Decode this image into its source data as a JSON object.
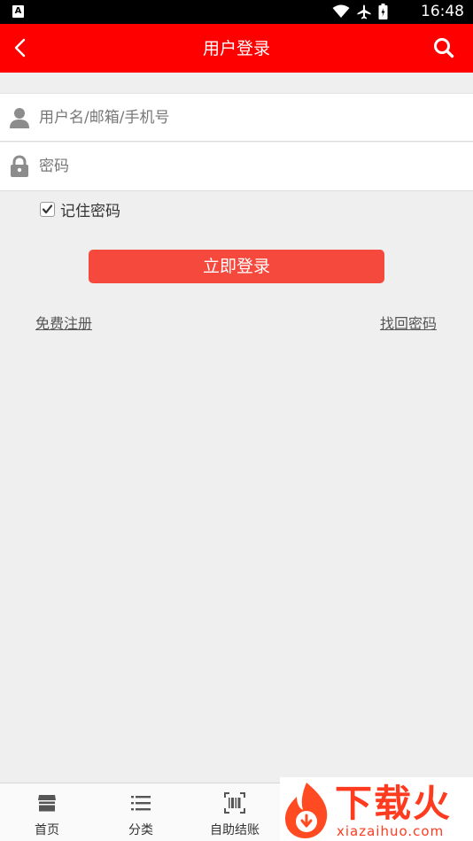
{
  "status_bar": {
    "app_badge": "A",
    "time": "16:48",
    "icons": [
      "wifi-icon",
      "airplane-icon",
      "battery-icon"
    ]
  },
  "header": {
    "title": "用户登录",
    "back_icon": "chevron-left-icon",
    "search_icon": "search-icon",
    "color": "#ff0000"
  },
  "form": {
    "username": {
      "value": "",
      "placeholder": "用户名/邮箱/手机号",
      "icon": "user-icon"
    },
    "password": {
      "value": "",
      "placeholder": "密码",
      "icon": "lock-icon"
    },
    "remember": {
      "label": "记住密码",
      "checked": true
    },
    "login_button": "立即登录",
    "register_link": "免费注册",
    "forgot_link": "找回密码",
    "button_color": "#f5493e"
  },
  "tabbar": {
    "items": [
      {
        "label": "首页",
        "icon": "store-icon"
      },
      {
        "label": "分类",
        "icon": "list-icon"
      },
      {
        "label": "自助结账",
        "icon": "barcode-scan-icon"
      }
    ]
  },
  "watermark": {
    "text": "下载火",
    "url": "xiazaihuo.com"
  }
}
